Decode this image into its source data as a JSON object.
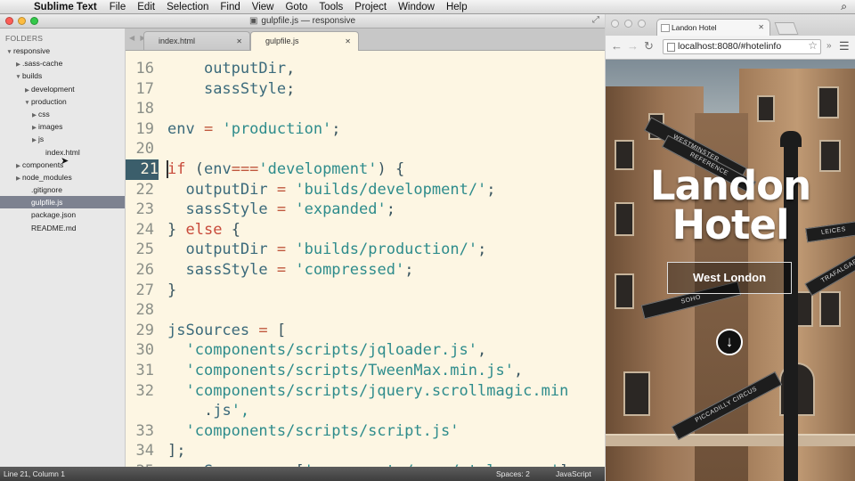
{
  "menubar": {
    "app_name": "Sublime Text",
    "items": [
      "File",
      "Edit",
      "Selection",
      "Find",
      "View",
      "Goto",
      "Tools",
      "Project",
      "Window",
      "Help"
    ]
  },
  "sublime": {
    "window_title": "gulpfile.js — responsive",
    "sidebar": {
      "header": "FOLDERS",
      "tree": [
        {
          "label": "responsive",
          "arrow": "▼"
        },
        {
          "label": ".sass-cache",
          "arrow": "▶"
        },
        {
          "label": "builds",
          "arrow": "▼"
        },
        {
          "label": "development",
          "arrow": "▶"
        },
        {
          "label": "production",
          "arrow": "▼"
        },
        {
          "label": "css",
          "arrow": "▶"
        },
        {
          "label": "images",
          "arrow": "▶"
        },
        {
          "label": "js",
          "arrow": "▶"
        },
        {
          "label": "index.html",
          "arrow": ""
        },
        {
          "label": "components",
          "arrow": "▶"
        },
        {
          "label": "node_modules",
          "arrow": "▶"
        },
        {
          "label": ".gitignore",
          "arrow": ""
        },
        {
          "label": "gulpfile.js",
          "arrow": "",
          "selected": true
        },
        {
          "label": "package.json",
          "arrow": ""
        },
        {
          "label": "README.md",
          "arrow": ""
        }
      ]
    },
    "tabs": [
      {
        "label": "index.html",
        "active": false
      },
      {
        "label": "gulpfile.js",
        "active": true
      }
    ],
    "line_numbers": [
      "16",
      "17",
      "18",
      "19",
      "20",
      "21",
      "22",
      "23",
      "24",
      "25",
      "26",
      "27",
      "28",
      "29",
      "30",
      "31",
      "32",
      "",
      "33",
      "34",
      "35"
    ],
    "current_line": "21",
    "code_lines": [
      "    outputDir,",
      "    sassStyle;",
      "",
      "env = 'production';",
      "",
      "if (env==='development') {",
      "  outputDir = 'builds/development/';",
      "  sassStyle = 'expanded';",
      "} else {",
      "  outputDir = 'builds/production/';",
      "  sassStyle = 'compressed';",
      "}",
      "",
      "jsSources = [",
      "  'components/scripts/jqloader.js',",
      "  'components/scripts/TweenMax.min.js',",
      "  'components/scripts/jquery.scrollmagic.min",
      "    .js',",
      "  'components/scripts/script.js'",
      "];",
      "sassSources = ['components/sass/style.scss'];"
    ],
    "status": {
      "position": "Line 21, Column 1",
      "spaces": "Spaces: 2",
      "language": "JavaScript"
    }
  },
  "browser": {
    "tab_title": "Landon Hotel",
    "url": "localhost:8080/#hotelinfo",
    "hero": {
      "title_line1": "Landon",
      "title_line2": "Hotel",
      "subtitle": "West London",
      "signs": [
        "WESTMINSTER",
        "REFERENCE",
        "SOHO",
        "TRAFALGAR",
        "PICCADILLY CIRCUS",
        "LEICES"
      ]
    }
  }
}
